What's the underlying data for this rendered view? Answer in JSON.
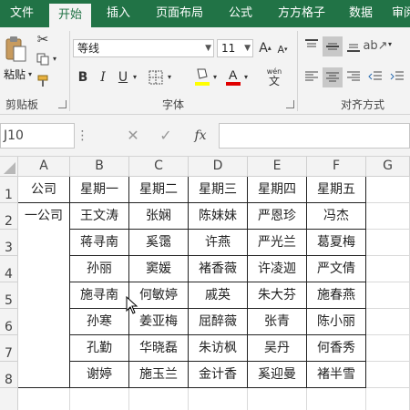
{
  "ribbon_tabs": [
    "文件",
    "开始",
    "插入",
    "页面布局",
    "公式",
    "方方格子",
    "数据",
    "审阅"
  ],
  "ribbon": {
    "clipboard": {
      "paste_label": "粘贴",
      "group_label": "剪贴板"
    },
    "font": {
      "font_name": "等线",
      "font_size": "11",
      "bold": "B",
      "italic": "I",
      "underline": "U",
      "phonetic": "wén",
      "group_label": "字体"
    },
    "alignment": {
      "group_label": "对齐方式"
    }
  },
  "formula_bar": {
    "name_box": "J10",
    "fx_label": "fx",
    "formula": ""
  },
  "columns": [
    "A",
    "B",
    "C",
    "D",
    "E",
    "F",
    "G"
  ],
  "rows": [
    "1",
    "2",
    "3",
    "4",
    "5",
    "6",
    "7",
    "8"
  ],
  "sheet": {
    "header_row": [
      "公司",
      "星期一",
      "星期二",
      "星期三",
      "星期四",
      "星期五"
    ],
    "merged_company": "一公司",
    "names": [
      [
        "王文涛",
        "张娴",
        "陈妹妹",
        "严恩珍",
        "冯杰"
      ],
      [
        "蒋寻南",
        "奚霭",
        "许燕",
        "严光兰",
        "葛夏梅"
      ],
      [
        "孙丽",
        "窦媛",
        "褚香薇",
        "许凌迦",
        "严文倩"
      ],
      [
        "施寻南",
        "何敏婷",
        "戚英",
        "朱大芬",
        "施春燕"
      ],
      [
        "孙寒",
        "姜亚梅",
        "屈醉薇",
        "张青",
        "陈小丽"
      ],
      [
        "孔勤",
        "华晓磊",
        "朱访枫",
        "吴丹",
        "何香秀"
      ],
      [
        "谢婷",
        "施玉兰",
        "金计香",
        "奚迎曼",
        "褚半雪"
      ]
    ]
  }
}
